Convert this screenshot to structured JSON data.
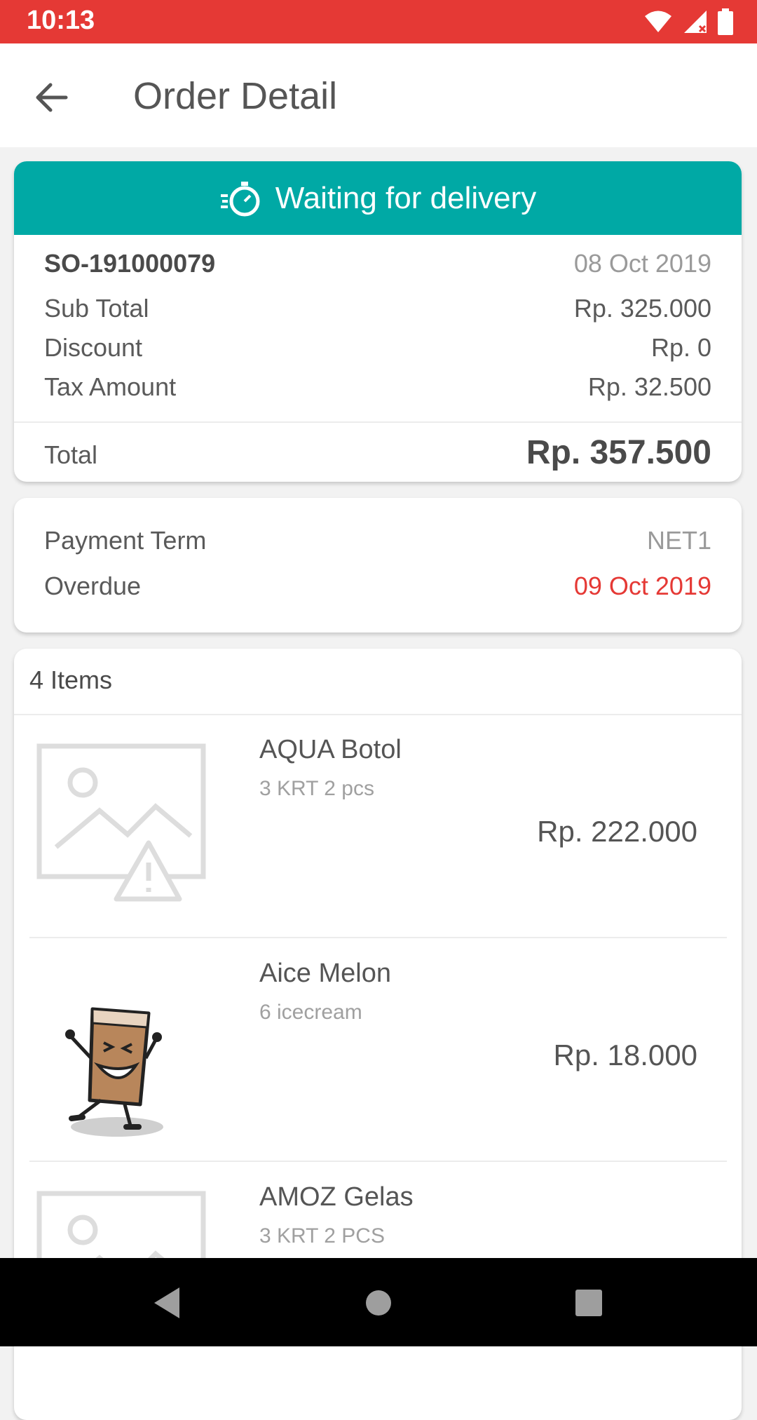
{
  "status_bar": {
    "time": "10:13"
  },
  "header": {
    "title": "Order Detail"
  },
  "order": {
    "status": "Waiting for delivery",
    "number": "SO-191000079",
    "date": "08 Oct 2019",
    "sub_total_label": "Sub Total",
    "sub_total": "Rp. 325.000",
    "discount_label": "Discount",
    "discount": "Rp. 0",
    "tax_label": "Tax Amount",
    "tax": "Rp. 32.500",
    "total_label": "Total",
    "total": "Rp. 357.500"
  },
  "payment": {
    "term_label": "Payment Term",
    "term": "NET1",
    "overdue_label": "Overdue",
    "overdue": "09 Oct 2019"
  },
  "items": {
    "count_label": "4 Items",
    "list": [
      {
        "name": "AQUA Botol",
        "qty": "3 KRT 2 pcs",
        "price": "Rp. 222.000",
        "image": "placeholder-image-icon"
      },
      {
        "name": "Aice Melon",
        "qty": "6 icecream",
        "price": "Rp. 18.000",
        "image": "icecream-mascot"
      },
      {
        "name": "AMOZ  Gelas",
        "qty": "3 KRT 2 PCS",
        "price": "",
        "image": "placeholder-image-icon"
      }
    ]
  },
  "colors": {
    "status_bar": "#e53935",
    "banner": "#00a9a5",
    "overdue": "#e53935"
  }
}
